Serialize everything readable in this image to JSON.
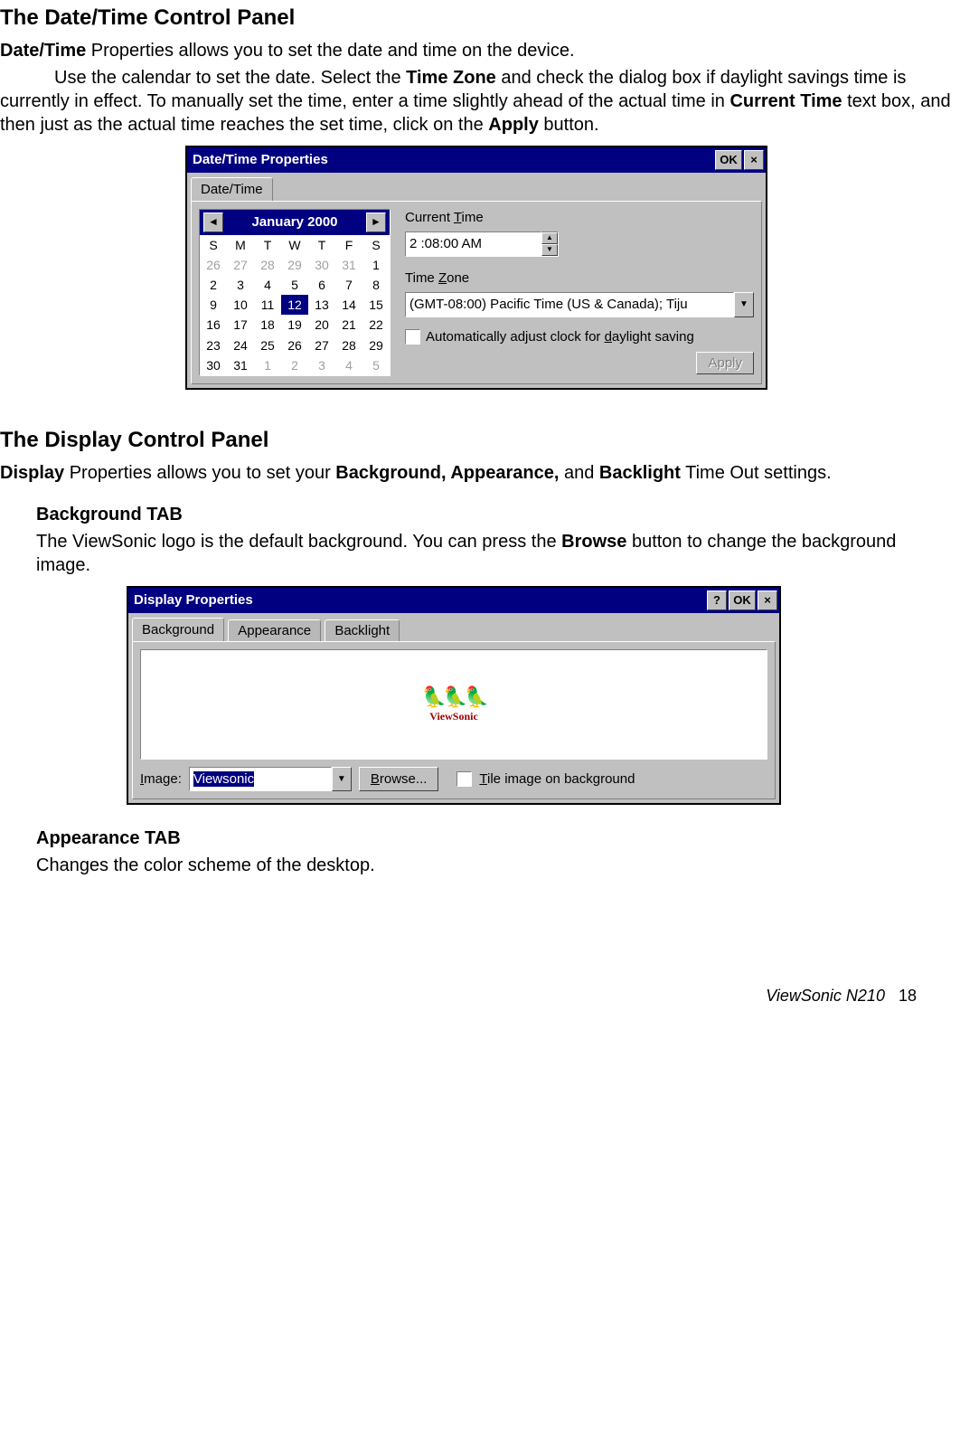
{
  "doc": {
    "h1": "The Date/Time Control Panel",
    "p1_lead": "Date/Time",
    "p1_rest": " Properties allows you to set the date and time on the device.",
    "p2_a": "Use the calendar to set the date. Select the ",
    "p2_b": "Time Zone",
    "p2_c": " and check the dialog box if daylight savings time is currently in effect. To manually set the time, enter a time slightly ahead of the actual time in ",
    "p2_d": "Current Time",
    "p2_e": " text box, and then just as the actual time reaches the set time, click on the ",
    "p2_f": "Apply",
    "p2_g": " button.",
    "h2": "The Display Control Panel",
    "p3_a": "Display",
    "p3_b": " Properties allows you to set your ",
    "p3_c": "Background, Appearance,",
    "p3_d": " and ",
    "p3_e": "Backlight",
    "p3_f": " Time Out settings.",
    "bg_h": "Background TAB",
    "bg_p_a": "The ViewSonic logo is the default background. You can press the ",
    "bg_p_b": "Browse",
    "bg_p_c": " button to change the background image.",
    "ap_h": "Appearance TAB",
    "ap_p": "Changes the color scheme of the desktop.",
    "footer_brand": "ViewSonic   N210",
    "footer_page": "18"
  },
  "datetime": {
    "title": "Date/Time Properties",
    "ok": "OK",
    "close": "×",
    "tab": "Date/Time",
    "month": "January 2000",
    "prev": "◄",
    "next": "►",
    "dow": [
      "S",
      "M",
      "T",
      "W",
      "T",
      "F",
      "S"
    ],
    "weeks": [
      [
        {
          "v": "26",
          "dim": true
        },
        {
          "v": "27",
          "dim": true
        },
        {
          "v": "28",
          "dim": true
        },
        {
          "v": "29",
          "dim": true
        },
        {
          "v": "30",
          "dim": true
        },
        {
          "v": "31",
          "dim": true
        },
        {
          "v": "1"
        }
      ],
      [
        {
          "v": "2"
        },
        {
          "v": "3"
        },
        {
          "v": "4"
        },
        {
          "v": "5"
        },
        {
          "v": "6"
        },
        {
          "v": "7"
        },
        {
          "v": "8"
        }
      ],
      [
        {
          "v": "9"
        },
        {
          "v": "10"
        },
        {
          "v": "11"
        },
        {
          "v": "12",
          "sel": true
        },
        {
          "v": "13"
        },
        {
          "v": "14"
        },
        {
          "v": "15"
        }
      ],
      [
        {
          "v": "16"
        },
        {
          "v": "17"
        },
        {
          "v": "18"
        },
        {
          "v": "19"
        },
        {
          "v": "20"
        },
        {
          "v": "21"
        },
        {
          "v": "22"
        }
      ],
      [
        {
          "v": "23"
        },
        {
          "v": "24"
        },
        {
          "v": "25"
        },
        {
          "v": "26"
        },
        {
          "v": "27"
        },
        {
          "v": "28"
        },
        {
          "v": "29"
        }
      ],
      [
        {
          "v": "30"
        },
        {
          "v": "31"
        },
        {
          "v": "1",
          "dim": true
        },
        {
          "v": "2",
          "dim": true
        },
        {
          "v": "3",
          "dim": true
        },
        {
          "v": "4",
          "dim": true
        },
        {
          "v": "5",
          "dim": true
        }
      ]
    ],
    "current_time_label_a": "Current ",
    "current_time_label_b": "T",
    "current_time_label_c": "ime",
    "current_time_value": "2 :08:00 AM",
    "spin_up": "▲",
    "spin_down": "▼",
    "timezone_label_a": "Time ",
    "timezone_label_b": "Z",
    "timezone_label_c": "one",
    "timezone_value": "(GMT-08:00) Pacific Time (US & Canada); Tiju",
    "drop": "▼",
    "dst_a": "Automatically adjust clock for ",
    "dst_b": "d",
    "dst_c": "aylight saving",
    "apply": "Apply"
  },
  "display": {
    "title": "Display Properties",
    "help": "?",
    "ok": "OK",
    "close": "×",
    "tabs": {
      "bg": "Background",
      "ap": "Appearance",
      "bl": "Backlight"
    },
    "logo_birds": "🦜🦜🦜",
    "logo_text": "ViewSonic",
    "image_label_a": "I",
    "image_label_b": "mage:",
    "image_value": "Viewsonic",
    "drop": "▼",
    "browse_a": "B",
    "browse_b": "rowse...",
    "tile_a": "T",
    "tile_b": "ile image on background"
  }
}
